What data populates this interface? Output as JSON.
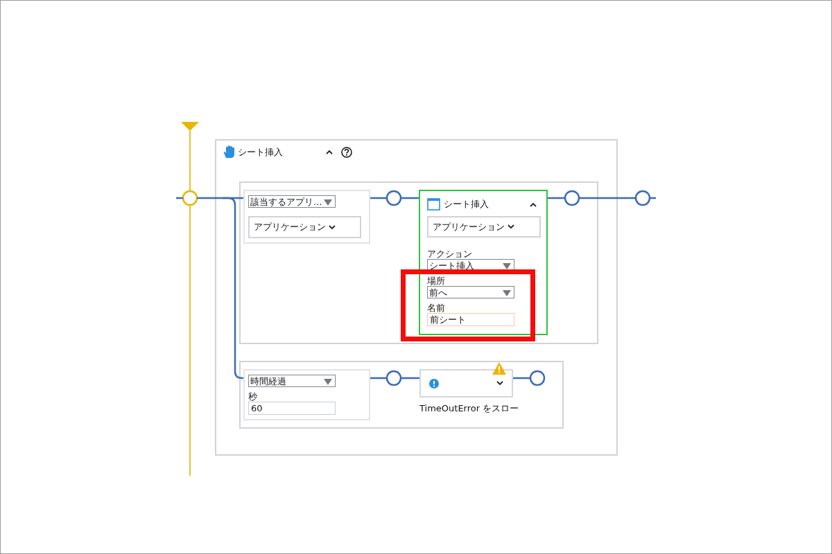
{
  "group": {
    "title": "シート挿入",
    "expanded": true
  },
  "branches": [
    {
      "condition": {
        "kind": "app",
        "select": "該当するアプリ...",
        "dropdown": "アプリケーション"
      },
      "action": {
        "kind": "step",
        "title": "シート挿入",
        "expanded": true,
        "selected": true,
        "dropdown": "アプリケーション",
        "fields": [
          {
            "label": "アクション",
            "kind": "select",
            "value": "シート挿入",
            "highlighted": false
          },
          {
            "label": "場所",
            "kind": "select",
            "value": "前へ",
            "highlighted": true
          },
          {
            "label": "名前",
            "kind": "input",
            "value": "前シート",
            "highlighted": true
          }
        ]
      }
    },
    {
      "condition": {
        "kind": "timer",
        "select": "時間経過",
        "label": "秒",
        "value": "60"
      },
      "action": {
        "kind": "throw",
        "text": "TimeOutError をスロー",
        "warning": true
      }
    }
  ]
}
